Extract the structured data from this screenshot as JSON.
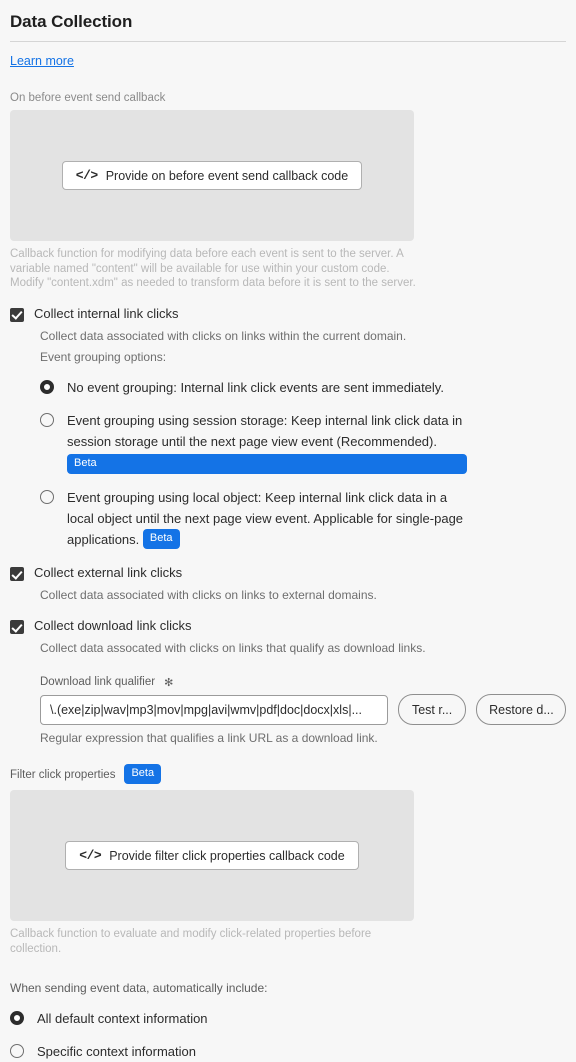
{
  "header": {
    "title": "Data Collection",
    "learn_more": "Learn more"
  },
  "on_before_event_send": {
    "label": "On before event send callback",
    "button_label": "Provide on before event send callback code",
    "code_icon": "code-icon",
    "help_text": "Callback function for modifying data before each event is sent to the server. A variable named \"content\" will be available for use within your custom code. Modify \"content.xdm\" as needed to transform data before it is sent to the server."
  },
  "internal_link_clicks": {
    "label": "Collect internal link clicks",
    "checked": true,
    "description": "Collect data associated with clicks on links within the current domain.",
    "grouping_label": "Event grouping options:",
    "options": [
      {
        "label": "No event grouping: Internal link click events are sent immediately.",
        "selected": true,
        "badge": ""
      },
      {
        "label": "Event grouping using session storage: Keep internal link click data in session storage until the next page view event (Recommended).",
        "selected": false,
        "badge": "Beta"
      },
      {
        "label": "Event grouping using local object: Keep internal link click data in a local object until the next page view event. Applicable for single-page applications.",
        "selected": false,
        "badge": "Beta"
      }
    ]
  },
  "external_link_clicks": {
    "label": "Collect external link clicks",
    "checked": true,
    "description": "Collect data associated with clicks on links to external domains."
  },
  "download_link_clicks": {
    "label": "Collect download link clicks",
    "checked": true,
    "description": "Collect data assocated with clicks on links that qualify as download links.",
    "qualifier_label": "Download link qualifier",
    "required_marker": "✻",
    "qualifier_value": "\\.(exe|zip|wav|mp3|mov|mpg|avi|wmv|pdf|doc|docx|xls|...",
    "test_button": "Test r...",
    "restore_button": "Restore d...",
    "qualifier_help": "Regular expression that qualifies a link URL as a download link."
  },
  "filter_click_properties": {
    "label": "Filter click properties",
    "badge": "Beta",
    "button_label": "Provide filter click properties callback code",
    "code_icon": "code-icon",
    "help_text": "Callback function to evaluate and modify click-related properties before collection."
  },
  "context_information": {
    "prompt": "When sending event data, automatically include:",
    "options": [
      {
        "label": "All default context information",
        "selected": true
      },
      {
        "label": "Specific context information",
        "selected": false
      }
    ]
  },
  "colors": {
    "accent": "#1473e6",
    "page_background": "#f7f7f7",
    "panel_background": "#e3e3e3",
    "control_dark": "#2c2c2c"
  }
}
